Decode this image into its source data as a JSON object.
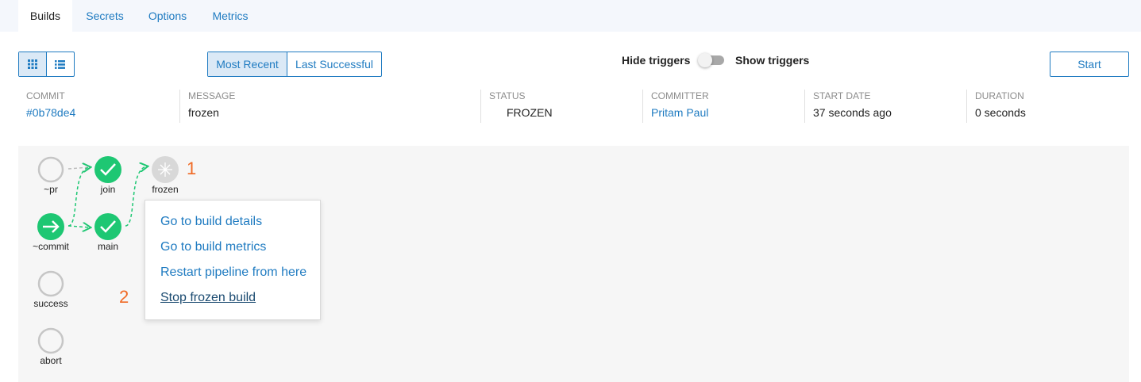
{
  "tabs": [
    {
      "label": "Builds",
      "active": true
    },
    {
      "label": "Secrets",
      "active": false
    },
    {
      "label": "Options",
      "active": false
    },
    {
      "label": "Metrics",
      "active": false
    }
  ],
  "toolbar": {
    "view_icons": [
      "grid-icon",
      "list-icon"
    ],
    "segment": [
      "Most Recent",
      "Last Successful"
    ],
    "hide_triggers": "Hide triggers",
    "show_triggers": "Show triggers",
    "start": "Start"
  },
  "build_info": {
    "commit": {
      "header": "COMMIT",
      "value": "#0b78de4"
    },
    "message": {
      "header": "MESSAGE",
      "value": "frozen"
    },
    "status": {
      "header": "STATUS",
      "value": "FROZEN"
    },
    "committer": {
      "header": "COMMITTER",
      "value": "Pritam Paul"
    },
    "start_date": {
      "header": "START DATE",
      "value": "37 seconds ago"
    },
    "duration": {
      "header": "DURATION",
      "value": "0 seconds"
    }
  },
  "pipeline": {
    "nodes": {
      "pr": {
        "label": "~pr",
        "state": "pending"
      },
      "commit": {
        "label": "~commit",
        "state": "running"
      },
      "join": {
        "label": "join",
        "state": "success"
      },
      "main": {
        "label": "main",
        "state": "success"
      },
      "frozen": {
        "label": "frozen",
        "state": "frozen"
      },
      "success": {
        "label": "success",
        "state": "pending"
      },
      "abort": {
        "label": "abort",
        "state": "pending"
      }
    },
    "markers": [
      "1",
      "2"
    ]
  },
  "context_menu": {
    "items": [
      "Go to build details",
      "Go to build metrics",
      "Restart pipeline from here",
      "Stop frozen build"
    ]
  },
  "colors": {
    "accent": "#1f7bc1",
    "success": "#1ec773",
    "marker": "#f06a25"
  }
}
